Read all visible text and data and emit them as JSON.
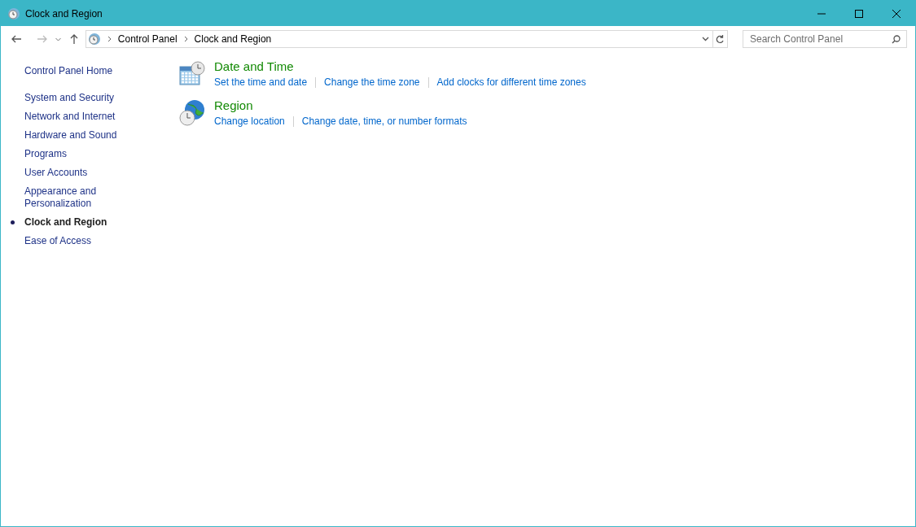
{
  "window": {
    "title": "Clock and Region"
  },
  "address_bar": {
    "crumbs": [
      "Control Panel",
      "Clock and Region"
    ]
  },
  "search": {
    "placeholder": "Search Control Panel"
  },
  "sidebar": {
    "home": "Control Panel Home",
    "items": [
      {
        "label": "System and Security",
        "selected": false
      },
      {
        "label": "Network and Internet",
        "selected": false
      },
      {
        "label": "Hardware and Sound",
        "selected": false
      },
      {
        "label": "Programs",
        "selected": false
      },
      {
        "label": "User Accounts",
        "selected": false
      },
      {
        "label": "Appearance and Personalization",
        "selected": false
      },
      {
        "label": "Clock and Region",
        "selected": true
      },
      {
        "label": "Ease of Access",
        "selected": false
      }
    ]
  },
  "sections": [
    {
      "kind": "calendar",
      "title": "Date and Time",
      "links": [
        "Set the time and date",
        "Change the time zone",
        "Add clocks for different time zones"
      ]
    },
    {
      "kind": "globe",
      "title": "Region",
      "links": [
        "Change location",
        "Change date, time, or number formats"
      ]
    }
  ]
}
